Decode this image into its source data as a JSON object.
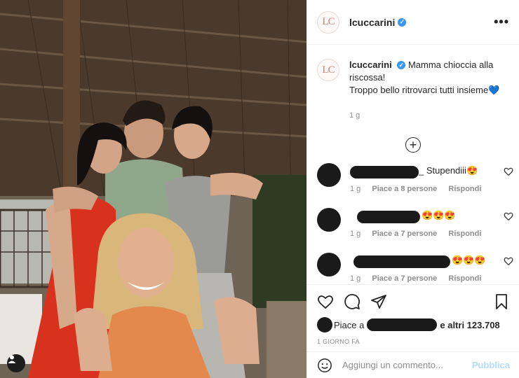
{
  "post": {
    "username": "lcuccarini",
    "avatar_initials": "LC",
    "verified_mark": "✓",
    "more_glyph": "•••"
  },
  "caption": {
    "username": "lcuccarini",
    "line1": "Mamma chioccia alla riscossa!",
    "line2": "Troppo bello ritrovarci tutti insieme",
    "line2_emoji": "💙",
    "time": "1 g"
  },
  "comments": [
    {
      "text": "_ Stupendiii😍",
      "time": "1 g",
      "likes": "Piace a 8 persone",
      "reply": "Rispondi"
    },
    {
      "text": "😍😍😍",
      "time": "1 g",
      "likes": "Piace a 7 persone",
      "reply": "Rispondi"
    },
    {
      "text": "😍😍😍",
      "time": "1 g",
      "likes": "Piace a 7 persone",
      "reply": "Rispondi"
    }
  ],
  "likes": {
    "prefix": "Piace a",
    "suffix": "e altri 123.708"
  },
  "date": "1 GIORNO FA",
  "add_comment": {
    "placeholder": "Aggiungi un commento...",
    "publish": "Pubblica"
  },
  "icons": {
    "more": "more-icon",
    "load_more": "plus-circle-icon",
    "like": "heart-icon",
    "comment": "comment-icon",
    "share": "share-icon",
    "save": "bookmark-icon",
    "emoji": "emoji-icon",
    "user_tag": "user-tag-icon"
  }
}
